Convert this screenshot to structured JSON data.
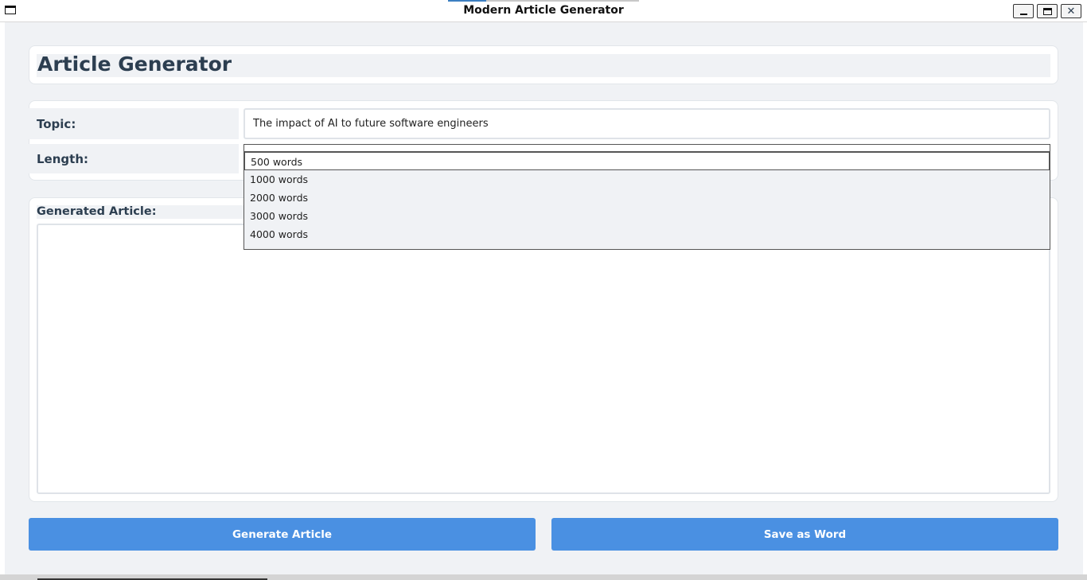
{
  "window": {
    "title": "Modern Article Generator"
  },
  "header": {
    "title": "Article Generator"
  },
  "form": {
    "topic_label": "Topic:",
    "topic_value": "The impact of AI to future software engineers",
    "length_label": "Length:",
    "length_options": [
      "500 words",
      "1000 words",
      "2000 words",
      "3000 words",
      "4000 words"
    ],
    "length_selected": "500 words"
  },
  "article": {
    "label": "Generated Article:",
    "content": ""
  },
  "actions": {
    "generate_label": "Generate Article",
    "save_label": "Save as Word"
  },
  "colors": {
    "accent": "#4a90e2",
    "background": "#f0f2f5",
    "text": "#2c3e50"
  }
}
